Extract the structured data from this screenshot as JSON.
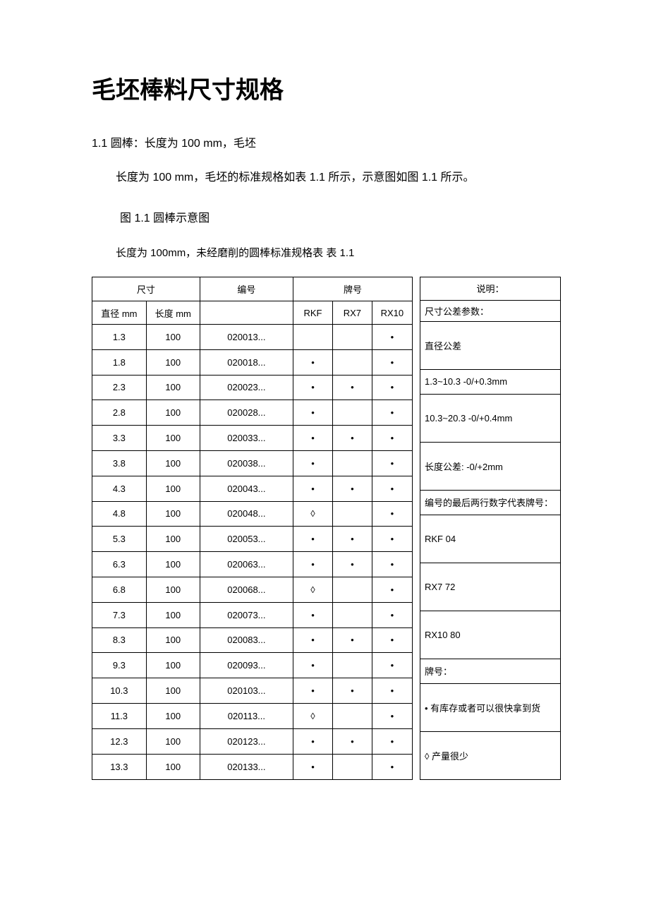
{
  "title": "毛坯棒料尺寸规格",
  "section": "1.1 圆棒：长度为 100 mm，毛坯",
  "intro": "长度为 100 mm，毛坯的标准规格如表 1.1 所示，示意图如图 1.1 所示。",
  "fig_caption": "图 1.1 圆棒示意图",
  "tab_caption": "长度为 100mm，未经磨削的圆棒标准规格表 表 1.1",
  "headers": {
    "size": "尺寸",
    "code": "编号",
    "grade": "牌号",
    "note": "说明：",
    "dia": "直径 mm",
    "len": "长度 mm",
    "g1": "RKF",
    "g2": "RX7",
    "g3": "RX10",
    "note_sub": "尺寸公差参数："
  },
  "rows": [
    {
      "d": "1.3",
      "l": "100",
      "c": "020013...",
      "g1": "",
      "g2": "",
      "g3": "•"
    },
    {
      "d": "1.8",
      "l": "100",
      "c": "020018...",
      "g1": "•",
      "g2": "",
      "g3": "•"
    },
    {
      "d": "2.3",
      "l": "100",
      "c": "020023...",
      "g1": "•",
      "g2": "•",
      "g3": "•"
    },
    {
      "d": "2.8",
      "l": "100",
      "c": "020028...",
      "g1": "•",
      "g2": "",
      "g3": "•"
    },
    {
      "d": "3.3",
      "l": "100",
      "c": "020033...",
      "g1": "•",
      "g2": "•",
      "g3": "•"
    },
    {
      "d": "3.8",
      "l": "100",
      "c": "020038...",
      "g1": "•",
      "g2": "",
      "g3": "•"
    },
    {
      "d": "4.3",
      "l": "100",
      "c": "020043...",
      "g1": "•",
      "g2": "•",
      "g3": "•"
    },
    {
      "d": "4.8",
      "l": "100",
      "c": "020048...",
      "g1": "◊",
      "g2": "",
      "g3": "•"
    },
    {
      "d": "5.3",
      "l": "100",
      "c": "020053...",
      "g1": "•",
      "g2": "•",
      "g3": "•"
    },
    {
      "d": "6.3",
      "l": "100",
      "c": "020063...",
      "g1": "•",
      "g2": "•",
      "g3": "•"
    },
    {
      "d": "6.8",
      "l": "100",
      "c": "020068...",
      "g1": "◊",
      "g2": "",
      "g3": "•"
    },
    {
      "d": "7.3",
      "l": "100",
      "c": "020073...",
      "g1": "•",
      "g2": "",
      "g3": "•"
    },
    {
      "d": "8.3",
      "l": "100",
      "c": "020083...",
      "g1": "•",
      "g2": "•",
      "g3": "•"
    },
    {
      "d": "9.3",
      "l": "100",
      "c": "020093...",
      "g1": "•",
      "g2": "",
      "g3": "•"
    },
    {
      "d": "10.3",
      "l": "100",
      "c": "020103...",
      "g1": "•",
      "g2": "•",
      "g3": "•"
    },
    {
      "d": "11.3",
      "l": "100",
      "c": "020113...",
      "g1": "◊",
      "g2": "",
      "g3": "•"
    },
    {
      "d": "12.3",
      "l": "100",
      "c": "020123...",
      "g1": "•",
      "g2": "•",
      "g3": "•"
    },
    {
      "d": "13.3",
      "l": "100",
      "c": "020133...",
      "g1": "•",
      "g2": "",
      "g3": "•"
    }
  ],
  "notes": {
    "n1": "直径公差",
    "n2": "1.3~10.3 -0/+0.3mm",
    "n3": "10.3~20.3 -0/+0.4mm",
    "n4": "长度公差: -0/+2mm",
    "n5": "编号的最后两行数字代表牌号：",
    "n6": "RKF 04",
    "n7": "RX7 72",
    "n8": "RX10 80",
    "n9": "牌号：",
    "n10": "• 有库存或者可以很快拿到货",
    "n11": "◊ 产量很少"
  }
}
